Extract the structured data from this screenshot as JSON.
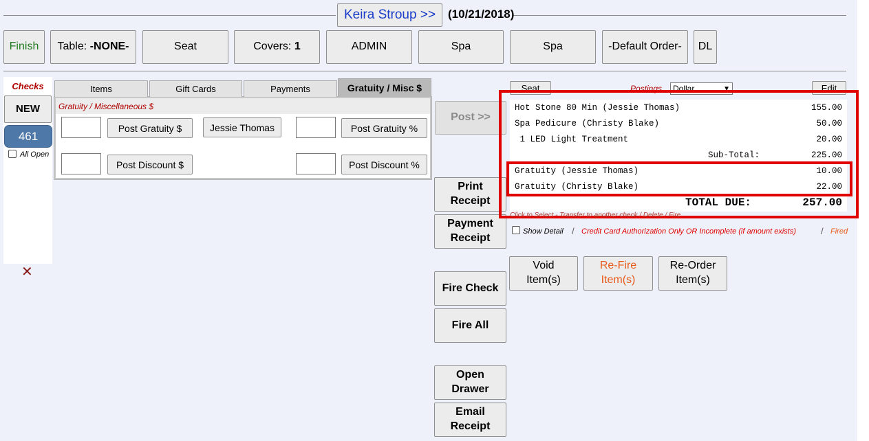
{
  "header": {
    "customer_name": "Keira Stroup >>",
    "date": "(10/21/2018)"
  },
  "toolbar": {
    "finish": "Finish",
    "table_prefix": "Table: ",
    "table_value": "-NONE-",
    "seat": "Seat",
    "covers_prefix": "Covers: ",
    "covers_value": "1",
    "admin": "ADMIN",
    "spa1": "Spa",
    "spa2": "Spa",
    "default_order": "-Default Order-",
    "dl": "DL"
  },
  "checks": {
    "title": "Checks",
    "new_label": "NEW",
    "check_number": "461",
    "all_open_label": "All Open"
  },
  "tabs": [
    {
      "label": "Items"
    },
    {
      "label": "Gift Cards"
    },
    {
      "label": "Payments"
    },
    {
      "label": "Gratuity / Misc $"
    }
  ],
  "gratuity_panel": {
    "title": "Gratuity / Miscellaneous $",
    "post_gratuity_amount": "Post Gratuity $",
    "employee": "Jessie Thomas",
    "post_gratuity_percent": "Post Gratuity %",
    "post_discount_amount": "Post Discount $",
    "post_discount_percent": "Post Discount %"
  },
  "actions": {
    "post": "Post >>",
    "print_receipt_1": "Print",
    "print_receipt_2": "Receipt",
    "payment_receipt_1": "Payment",
    "payment_receipt_2": "Receipt",
    "fire_check": "Fire Check",
    "fire_all": "Fire All",
    "open_drawer_1": "Open",
    "open_drawer_2": "Drawer",
    "email_receipt_1": "Email",
    "email_receipt_2": "Receipt",
    "void_1": "Void",
    "void_2": "Item(s)",
    "refire_1": "Re-Fire",
    "refire_2": "Item(s)",
    "reorder_1": "Re-Order",
    "reorder_2": "Item(s)"
  },
  "receipt_header": {
    "seat": "Seat",
    "postings_label": "Postings",
    "postings_value": "Dollar",
    "edit": "Edit"
  },
  "receipt": {
    "items": [
      {
        "name": "Hot Stone 80 Min (Jessie Thomas)",
        "amount": "155.00"
      },
      {
        "name": "Spa Pedicure (Christy Blake)",
        "amount": "50.00"
      },
      {
        "name": " 1 LED Light Treatment",
        "amount": "20.00"
      }
    ],
    "subtotal_label": "Sub-Total:",
    "subtotal": "225.00",
    "gratuities": [
      {
        "name": "Gratuity (Jessie Thomas)",
        "amount": "10.00"
      },
      {
        "name": "Gratuity (Christy Blake)",
        "amount": "22.00"
      }
    ],
    "total_label": "TOTAL DUE:",
    "total": "257.00"
  },
  "legend": {
    "hint": "Click to Select - Transfer to another check / Delete / Fire",
    "show_detail": "Show Detail",
    "sep": "/",
    "cc_note": "Credit Card Authorization Only OR Incomplete (if amount exists)",
    "fired": "Fired"
  },
  "colors": {
    "accent_blue": "#1a3cc8",
    "finish_green": "#1f7a1f",
    "highlight_red": "#e00000",
    "check_blue": "#4d78a8",
    "refire_orange": "#e85a1a",
    "checks_title": "#b00000"
  }
}
